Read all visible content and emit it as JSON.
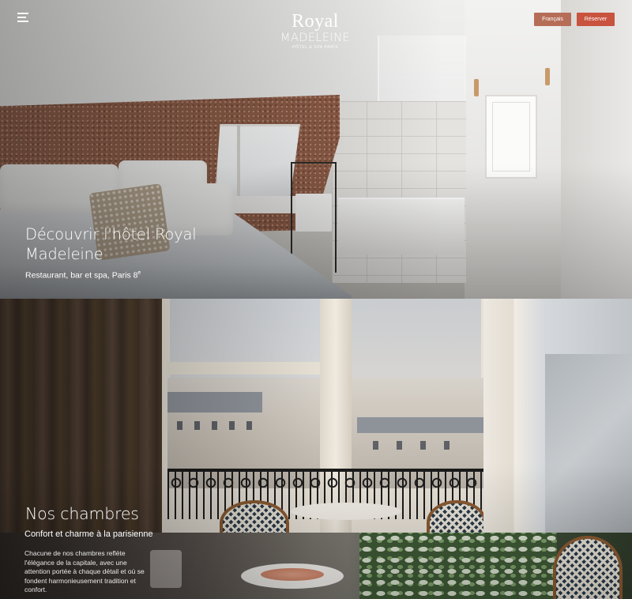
{
  "header": {
    "menu_icon": "hamburger-icon",
    "logo": {
      "line1": "Royal",
      "line2": "MADELEINE",
      "tagline": "HÔTEL & SPA PARIS"
    },
    "language_label": "Français",
    "book_label": "Réserver",
    "colors": {
      "language_button": "#b66d58",
      "book_button": "#c8533e"
    }
  },
  "hero": {
    "title": "Découvrir l'hôtel Royal Madeleine",
    "subtitle": "Restaurant, bar et spa, Paris 8",
    "subtitle_sup": "e"
  },
  "rooms": {
    "title": "Nos chambres",
    "subtitle": "Confort et charme à la parisienne",
    "description": "Chacune de nos chambres reflète l'élégance de la capitale, avec une attention portée à chaque détail et où se fondent harmonieusement tradition et  confort."
  }
}
